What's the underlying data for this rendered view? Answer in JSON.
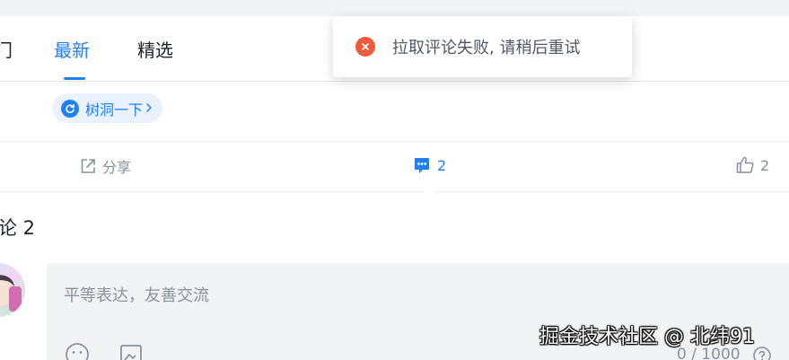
{
  "tabs": [
    {
      "label": "门"
    },
    {
      "label": "最新"
    },
    {
      "label": "精选"
    }
  ],
  "tree_hole": {
    "label": "树洞一下"
  },
  "actions": {
    "share": {
      "label": "分享"
    },
    "comment": {
      "count": "2"
    },
    "like": {
      "count": "2"
    }
  },
  "comments": {
    "title": "论 2"
  },
  "comment_input": {
    "placeholder": "平等表达，友善交流",
    "counter": "0 / 1000"
  },
  "toast": {
    "message": "拉取评论失败, 请稍后重试"
  },
  "watermark": "掘金技术社区 @ 北纬91",
  "colors": {
    "accent": "#1e80ff",
    "error": "#f05a3d"
  }
}
